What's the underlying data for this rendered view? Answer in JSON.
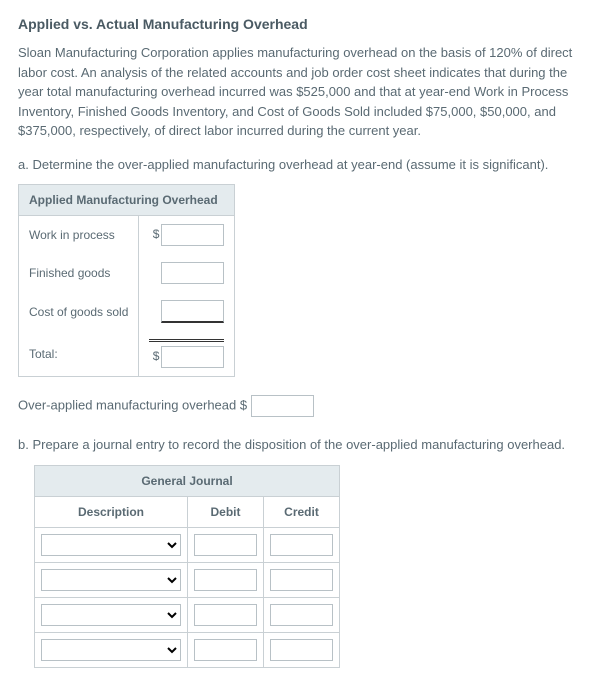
{
  "heading": "Applied vs. Actual Manufacturing Overhead",
  "intro": "Sloan Manufacturing Corporation applies manufacturing overhead on the basis of 120% of direct labor cost. An analysis of the related accounts and job order cost sheet indicates that during the year total manufacturing overhead incurred was $525,000 and that at year-end Work in Process Inventory, Finished Goods Inventory, and Cost of Goods Sold included $75,000, $50,000, and $375,000, respectively, of direct labor incurred during the current year.",
  "q_a": "a. Determine the over-applied manufacturing overhead at year-end (assume it is significant).",
  "amo": {
    "header": "Applied Manufacturing Overhead",
    "rows": [
      {
        "label": "Work in process",
        "prefix": "$"
      },
      {
        "label": "Finished goods",
        "prefix": ""
      },
      {
        "label": "Cost of goods sold",
        "prefix": ""
      },
      {
        "label": "Total:",
        "prefix": "$"
      }
    ]
  },
  "overapplied_label": "Over-applied manufacturing overhead $",
  "q_b": "b. Prepare a journal entry to record the disposition of the over-applied manufacturing overhead.",
  "gj": {
    "title": "General Journal",
    "cols": [
      "Description",
      "Debit",
      "Credit"
    ]
  }
}
